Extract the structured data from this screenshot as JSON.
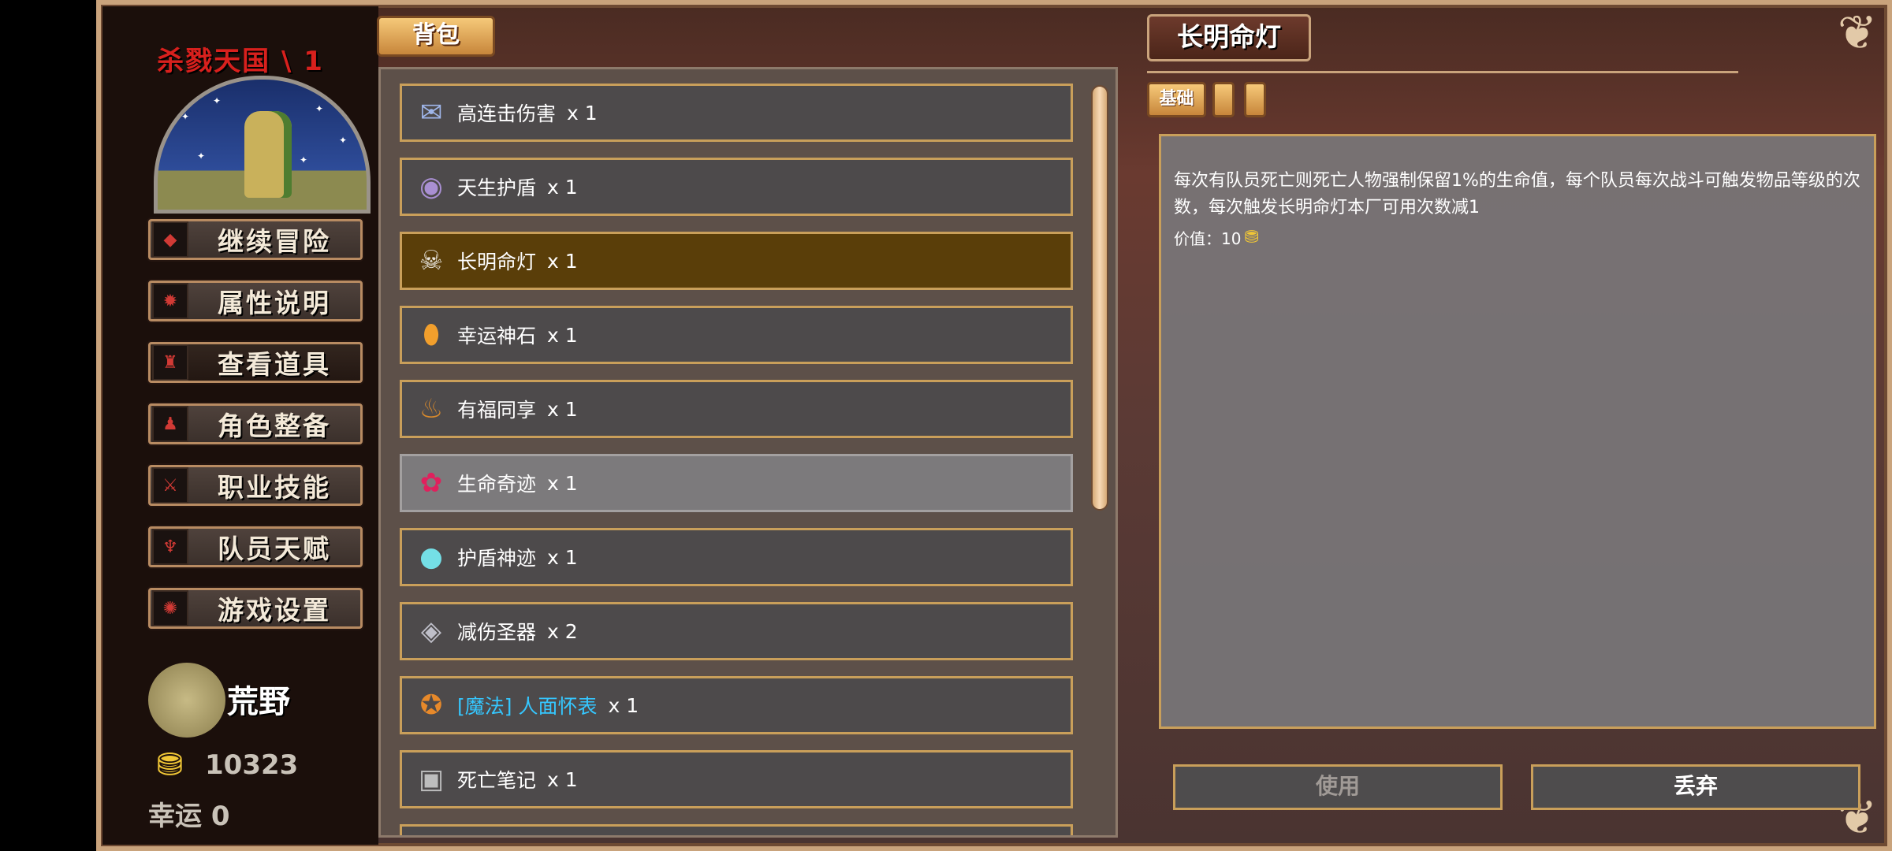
{
  "sidebar": {
    "game_title": "杀戮天国 \\ 1",
    "menu": [
      {
        "label": "继续冒险",
        "icon": "adventure-icon"
      },
      {
        "label": "属性说明",
        "icon": "attribute-icon"
      },
      {
        "label": "查看道具",
        "icon": "items-icon"
      },
      {
        "label": "角色整备",
        "icon": "character-icon"
      },
      {
        "label": "职业技能",
        "icon": "skill-icon"
      },
      {
        "label": "队员天赋",
        "icon": "talent-icon"
      },
      {
        "label": "游戏设置",
        "icon": "settings-icon"
      }
    ],
    "location": "荒野",
    "gold": "10323",
    "luck": "幸运 0"
  },
  "bag": {
    "tab_label": "背包",
    "items": [
      {
        "name": "高连击伤害",
        "qty": "x 1",
        "icon": "scroll-icon"
      },
      {
        "name": "天生护盾",
        "qty": "x 1",
        "icon": "shield-orb-icon"
      },
      {
        "name": "长明命灯",
        "qty": "x 1",
        "icon": "skull-lamp-icon"
      },
      {
        "name": "幸运神石",
        "qty": "x 1",
        "icon": "lucky-stone-icon"
      },
      {
        "name": "有福同享",
        "qty": "x 1",
        "icon": "cauldron-icon"
      },
      {
        "name": "生命奇迹",
        "qty": "x 1",
        "icon": "life-berry-icon"
      },
      {
        "name": "护盾神迹",
        "qty": "x 1",
        "icon": "shield-sphere-icon"
      },
      {
        "name": "减伤圣器",
        "qty": "x 2",
        "icon": "holy-relic-icon"
      },
      {
        "name": "[魔法] 人面怀表",
        "qty": "x 1",
        "icon": "pocket-watch-icon"
      },
      {
        "name": "死亡笔记",
        "qty": "x 1",
        "icon": "death-note-icon"
      }
    ]
  },
  "detail": {
    "title": "长明命灯",
    "tab_basic": "基础",
    "description": "每次有队员死亡则死亡人物强制保留1%的生命值，每个队员每次战斗可触发物品等级的次数，每次触发长明命灯本厂可用次数减1",
    "value_label": "价值：10",
    "use_button": "使用",
    "discard_button": "丢弃"
  },
  "colors": {
    "title_red": "#d8201d",
    "magic_item": "#35c7ff",
    "gold": "#f0c636",
    "selected_row": "#5a3e09",
    "item_border": "#c99f5a"
  }
}
